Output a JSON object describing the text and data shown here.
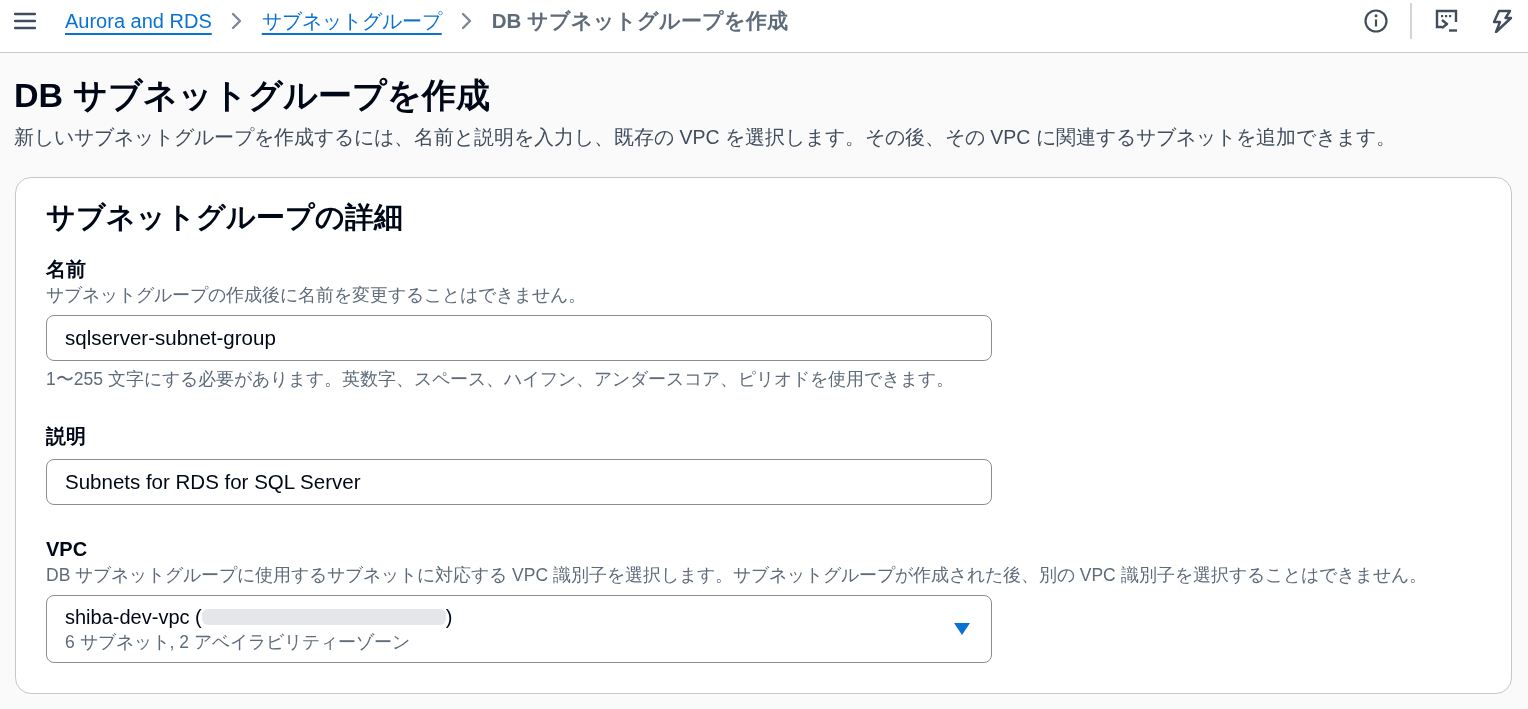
{
  "top_nav": {
    "breadcrumbs": [
      {
        "kind": "link",
        "label": "Aurora and RDS"
      },
      {
        "kind": "link",
        "label": "サブネットグループ"
      },
      {
        "kind": "current",
        "label": "DB サブネットグループを作成"
      }
    ]
  },
  "header": {
    "title": "DB サブネットグループを作成",
    "description": "新しいサブネットグループを作成するには、名前と説明を入力し、既存の VPC を選択します。その後、その VPC に関連するサブネットを追加できます。"
  },
  "panel": {
    "title": "サブネットグループの詳細",
    "fields": [
      {
        "kind": "text",
        "label": "名前",
        "description": "サブネットグループの作成後に名前を変更することはできません。",
        "value": "sqlserver-subnet-group",
        "constraint": "1〜255 文字にする必要があります。英数字、スペース、ハイフン、アンダースコア、ピリオドを使用できます。"
      },
      {
        "kind": "text",
        "label": "説明",
        "value": "Subnets for RDS for SQL Server"
      },
      {
        "kind": "select",
        "label": "VPC",
        "description": "DB サブネットグループに使用するサブネットに対応する VPC 識別子を選択します。サブネットグループが作成された後、別の VPC 識別子を選択することはできません。",
        "value": "shiba-dev-vpc (",
        "value_end": ")",
        "redacted": true,
        "details": "6 サブネット, 2 アベイラビリティーゾーン"
      }
    ]
  }
}
